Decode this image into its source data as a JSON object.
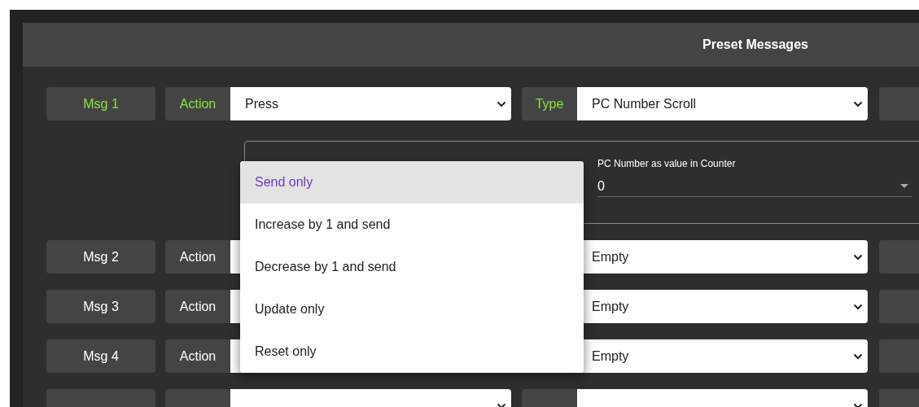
{
  "title": "Preset Messages",
  "messages": [
    {
      "label": "Msg 1",
      "expanded": true,
      "action_label": "Action",
      "action": "Press",
      "type_label": "Type",
      "type": "PC Number Scroll",
      "settings": {
        "counter_label": "PC Number as value in Counter",
        "counter_value": "0",
        "menu": [
          {
            "label": "Send only",
            "selected": true
          },
          {
            "label": "Increase by 1 and send",
            "selected": false
          },
          {
            "label": "Decrease by 1 and send",
            "selected": false
          },
          {
            "label": "Update only",
            "selected": false
          },
          {
            "label": "Reset only",
            "selected": false
          }
        ]
      }
    },
    {
      "label": "Msg 2",
      "expanded": false,
      "action_label": "Action",
      "type": "Empty"
    },
    {
      "label": "Msg 3",
      "expanded": false,
      "action_label": "Action",
      "type": "Empty"
    },
    {
      "label": "Msg 4",
      "expanded": false,
      "action_label": "Action",
      "type": "Empty"
    },
    {
      "expanded": false
    }
  ]
}
